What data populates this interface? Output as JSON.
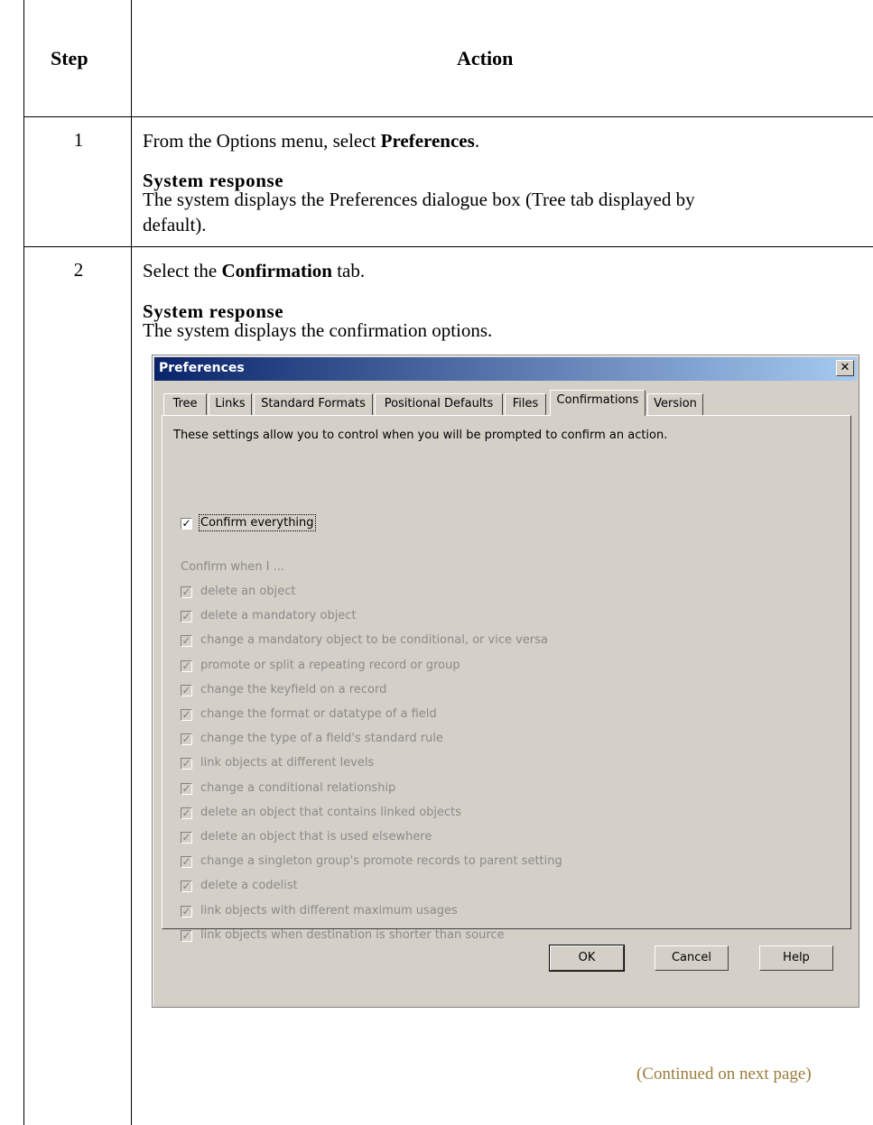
{
  "table": {
    "header_step": "Step",
    "header_action": "Action"
  },
  "rows": [
    {
      "step": "1",
      "instruction_prefix": "From the Options menu, select ",
      "instruction_bold": "Preferences",
      "instruction_suffix": ".",
      "response_heading": "System response",
      "response_line1": "The system displays the Preferences dialogue box (Tree tab displayed by",
      "response_line2": "default)."
    },
    {
      "step": "2",
      "instruction_prefix": "Select the ",
      "instruction_bold": "Confirmation",
      "instruction_suffix": " tab.",
      "response_heading": "System response",
      "response_line1": "The system displays the confirmation options."
    }
  ],
  "dialog": {
    "title": "Preferences",
    "close_glyph": "✕",
    "tabs": [
      "Tree",
      "Links",
      "Standard Formats",
      "Positional Defaults",
      "Files",
      "Confirmations",
      "Version"
    ],
    "active_tab": "Confirmations",
    "intro": "These settings allow you to control when you will be prompted to confirm an action.",
    "confirm_everything": {
      "label": "Confirm everything",
      "checked": true
    },
    "confirm_when_label": "Confirm when I ...",
    "options": [
      "delete an object",
      "delete a mandatory object",
      "change a mandatory object to be conditional, or vice versa",
      "promote or split a repeating record or group",
      "change the keyfield on a record",
      "change the format or datatype of a field",
      "change the type of a field's standard rule",
      "link objects at different levels",
      "change a conditional relationship",
      "delete an object that contains linked objects",
      "delete an object that is used elsewhere",
      "change a singleton group's promote records to parent setting",
      "delete a codelist",
      "link objects with different maximum usages",
      "link objects when destination is shorter than source"
    ],
    "buttons": {
      "ok": "OK",
      "cancel": "Cancel",
      "help": "Help"
    }
  },
  "footer": {
    "continued": "(Continued on next page)",
    "color": "#9b7c3c"
  }
}
